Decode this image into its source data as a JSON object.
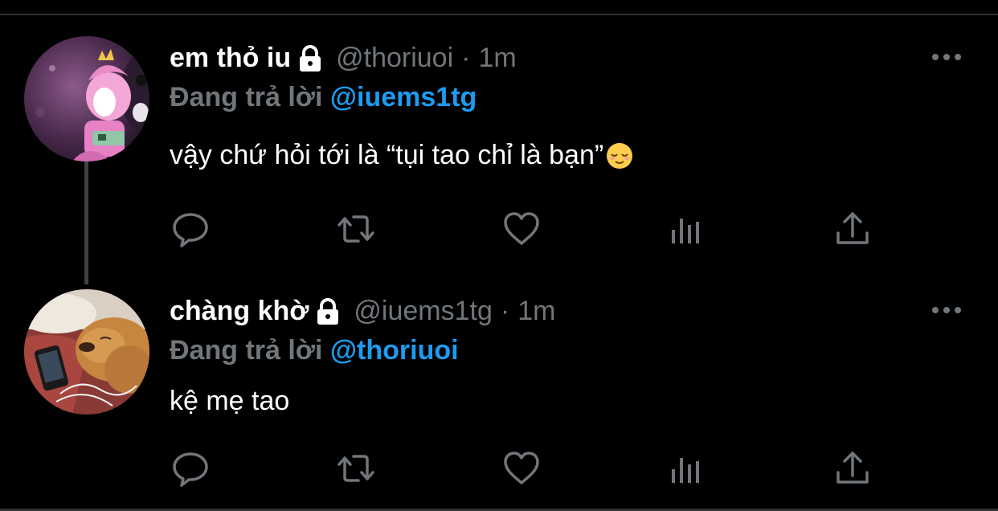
{
  "tweets": [
    {
      "display_name": "em thỏ iu",
      "handle": "@thoriuoi",
      "separator": "·",
      "time": "1m",
      "reply_prefix": "Đang trả lời",
      "reply_to": "@iuems1tg",
      "text": "vậy chứ hỏi tới là “tụi tao chỉ là bạn”",
      "emoji": "relieved-face"
    },
    {
      "display_name": "chàng khờ",
      "handle": "@iuems1tg",
      "separator": "·",
      "time": "1m",
      "reply_prefix": "Đang trả lời",
      "reply_to": "@thoriuoi",
      "text": "kệ mẹ tao"
    }
  ],
  "icons": [
    "lock-icon",
    "more-icon",
    "reply-icon",
    "retweet-icon",
    "like-icon",
    "analytics-icon",
    "share-icon"
  ],
  "colors": {
    "background": "#000000",
    "text": "#ffffff",
    "muted": "#71767b",
    "accent": "#1d9bf0",
    "divider": "#2f3336"
  }
}
